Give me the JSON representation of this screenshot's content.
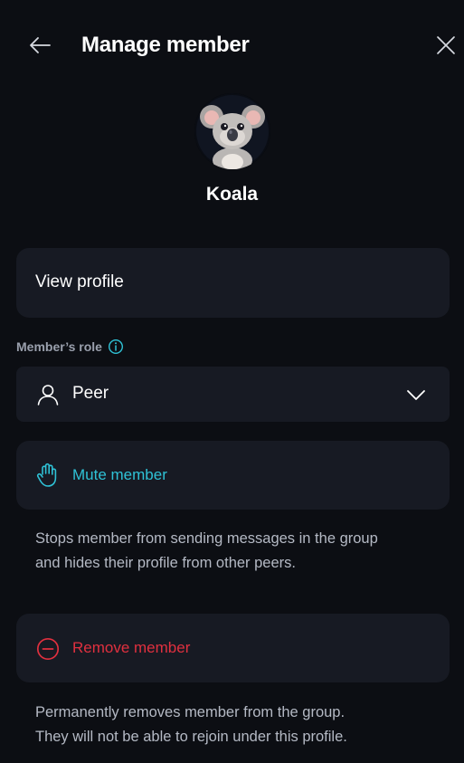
{
  "header": {
    "title": "Manage member",
    "back_icon": "arrow-left-icon",
    "close_icon": "close-icon"
  },
  "member": {
    "name": "Koala",
    "avatar_icon": "koala-avatar"
  },
  "view_profile": {
    "label": "View profile"
  },
  "role": {
    "label": "Member’s role",
    "info_icon": "info-icon",
    "selected": "Peer",
    "person_icon": "person-icon",
    "dropdown_icon": "chevron-down-icon"
  },
  "mute": {
    "label": "Mute member",
    "icon": "hand-icon",
    "color": "#2fc2d6",
    "description_line1": "Stops member from sending messages in the group",
    "description_line2": "and hides their profile from other peers."
  },
  "remove": {
    "label": "Remove member",
    "icon": "minus-circle-icon",
    "color": "#e0303f",
    "description_line1": "Permanently removes member from the group.",
    "description_line2": "They will not be able to rejoin under this profile."
  },
  "colors": {
    "background": "#0c0e13",
    "card": "#171a23",
    "muted_text": "#b4b9c4"
  }
}
